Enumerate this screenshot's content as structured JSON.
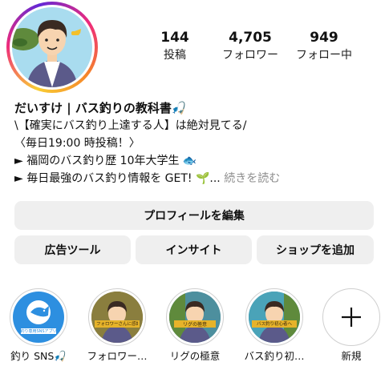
{
  "profile": {
    "avatar_icon": "profile-avatar-illustration"
  },
  "stats": [
    {
      "value": "144",
      "label": "投稿"
    },
    {
      "value": "4,705",
      "label": "フォロワー"
    },
    {
      "value": "949",
      "label": "フォロー中"
    }
  ],
  "bio": {
    "name": "だいすけ | バス釣りの教科書🎣",
    "line1": "\\【確実にバス釣り上達する人】は絶対見てる/",
    "line2": "〈毎日19:00 時投稿！〉",
    "line3": "► 福岡のバス釣り歴 10年大学生 🐟",
    "line4": "► 毎日最強のバス釣り情報を GET! 🌱...",
    "more": "続きを読む"
  },
  "buttons": {
    "edit_profile": "プロフィールを編集",
    "ad_tools": "広告ツール",
    "insights": "インサイト",
    "add_shop": "ショップを追加"
  },
  "highlights": [
    {
      "label": "釣り SNS🎣",
      "cover_text": "釣り専用SNSアプリ"
    },
    {
      "label": "フォロワー…",
      "cover_text": "フォロワーさんに感謝"
    },
    {
      "label": "リグの極意",
      "cover_text": "リグの極意"
    },
    {
      "label": "バス釣り初…",
      "cover_text": "バス釣り初心者へ"
    },
    {
      "label": "新規"
    }
  ],
  "colors": {
    "button_bg": "#efefef",
    "highlight_blue": "#2d8fe0",
    "gold_banner": "#e6b32a"
  }
}
